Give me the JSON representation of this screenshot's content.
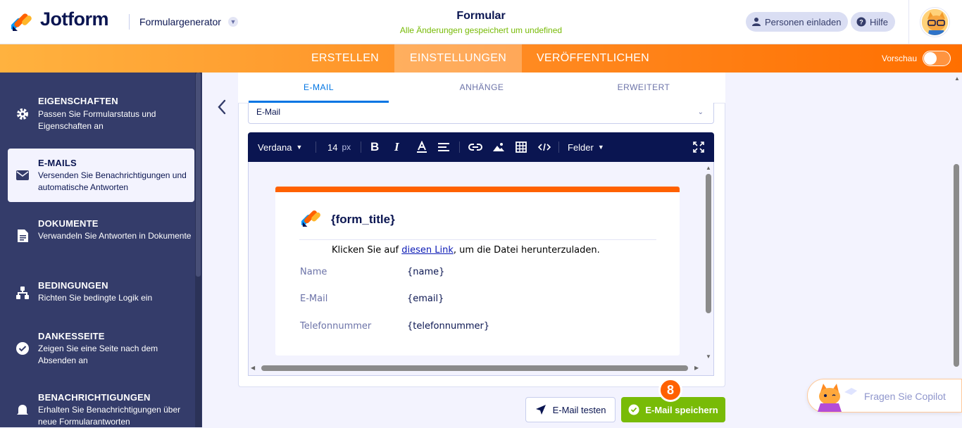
{
  "header": {
    "logo_text": "Jotform",
    "generator_label": "Formulargenerator",
    "form_title": "Formular",
    "save_status": "Alle Änderungen gespeichert um undefined",
    "invite_label": "Personen einladen",
    "help_label": "Hilfe"
  },
  "nav": {
    "tabs": [
      "ERSTELLEN",
      "EINSTELLUNGEN",
      "VERÖFFENTLICHEN"
    ],
    "active_tab": "EINSTELLUNGEN",
    "preview_label": "Vorschau"
  },
  "sidebar": {
    "items": [
      {
        "title": "EIGENSCHAFTEN",
        "desc": "Passen Sie Formularstatus und Eigenschaften an",
        "icon": "gear-icon"
      },
      {
        "title": "E-MAILS",
        "desc": "Versenden Sie Benachrichtigungen und automatische Antworten",
        "icon": "envelope-icon",
        "active": true
      },
      {
        "title": "DOKUMENTE",
        "desc": "Verwandeln Sie Antworten in Dokumente",
        "icon": "document-icon"
      },
      {
        "title": "BEDINGUNGEN",
        "desc": "Richten Sie bedingte Logik ein",
        "icon": "logic-tree-icon"
      },
      {
        "title": "DANKESSEITE",
        "desc": "Zeigen Sie eine Seite nach dem Absenden an",
        "icon": "check-circle-icon"
      },
      {
        "title": "BENACHRICHTIGUNGEN",
        "desc": "Erhalten Sie Benachrichtigungen über neue Formularantworten",
        "icon": "bell-icon"
      }
    ]
  },
  "email_panel": {
    "tabs": [
      "E-MAIL",
      "ANHÄNGE",
      "ERWEITERT"
    ],
    "active_tab": "E-MAIL",
    "type_select": "E-Mail",
    "toolbar": {
      "font": "Verdana",
      "size": "14",
      "size_unit": "px",
      "fields_label": "Felder"
    },
    "content": {
      "title": "{form_title}",
      "text_before": "Klicken Sie auf ",
      "link_text": "diesen Link",
      "text_after": ", um die Datei herunterzuladen.",
      "fields": [
        {
          "label": "Name",
          "value": "{name}"
        },
        {
          "label": "E-Mail",
          "value": "{email}"
        },
        {
          "label": "Telefonnummer",
          "value": "{telefonnummer}"
        }
      ]
    },
    "test_button": "E-Mail testen",
    "save_button": "E-Mail speichern",
    "step_badge": "8"
  },
  "copilot": {
    "label": "Fragen Sie Copilot"
  },
  "colors": {
    "accent": "#ff6100",
    "brand_dark": "#0a1551",
    "success": "#78bb07",
    "link": "#0075e3"
  }
}
